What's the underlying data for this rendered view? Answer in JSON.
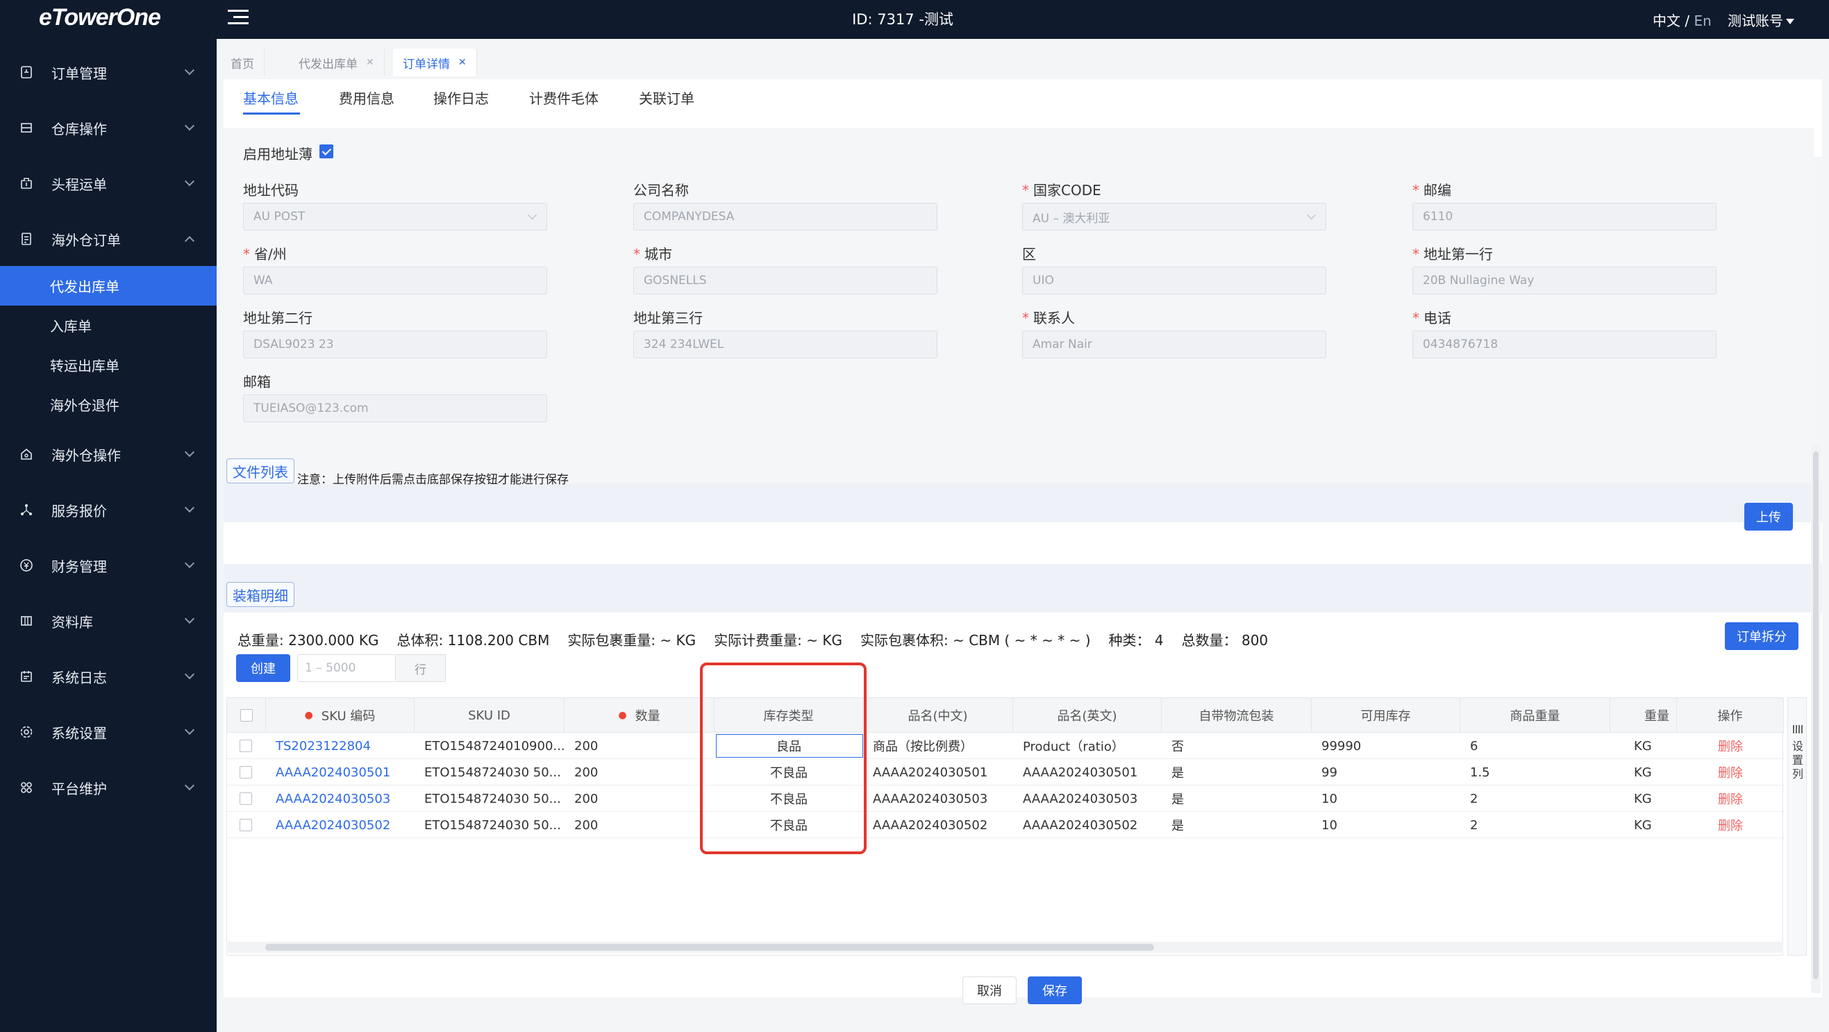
{
  "topbar": {
    "logo": "eTowerOne",
    "title": "ID: 7317 -测试",
    "lang_zh": "中文 / ",
    "lang_en": "En",
    "account": "测试账号"
  },
  "sidebar": {
    "items": [
      {
        "label": "订单管理",
        "icon": "order-icon"
      },
      {
        "label": "仓库操作",
        "icon": "warehouse-icon"
      },
      {
        "label": "头程运单",
        "icon": "shipment-icon"
      },
      {
        "label": "海外仓订单",
        "icon": "document-icon"
      },
      {
        "label": "海外仓操作",
        "icon": "overseas-warehouse-icon"
      },
      {
        "label": "服务报价",
        "icon": "quote-icon"
      },
      {
        "label": "财务管理",
        "icon": "finance-icon"
      },
      {
        "label": "资料库",
        "icon": "database-icon"
      },
      {
        "label": "系统日志",
        "icon": "log-icon"
      },
      {
        "label": "系统设置",
        "icon": "settings-icon"
      },
      {
        "label": "平台维护",
        "icon": "platform-icon"
      }
    ],
    "sub_items": [
      "代发出库单",
      "入库单",
      "转运出库单",
      "海外仓退件"
    ]
  },
  "page_tabs": [
    "首页",
    "代发出库单",
    "订单详情"
  ],
  "sub_tabs": [
    "基本信息",
    "费用信息",
    "操作日志",
    "计费件毛体",
    "关联订单"
  ],
  "address": {
    "use_book_label": "启用地址薄",
    "fields": [
      {
        "label": "地址代码",
        "value": "AU POST",
        "required": false
      },
      {
        "label": "公司名称",
        "value": "COMPANYDESA",
        "required": false
      },
      {
        "label": "国家CODE",
        "value": "AU – 澳大利亚",
        "required": true
      },
      {
        "label": "邮编",
        "value": "6110",
        "required": true
      },
      {
        "label": "省/州",
        "value": "WA",
        "required": true
      },
      {
        "label": "城市",
        "value": "GOSNELLS",
        "required": true
      },
      {
        "label": "区",
        "value": "UIO",
        "required": false
      },
      {
        "label": "地址第一行",
        "value": "20B Nullagine Way",
        "required": true
      },
      {
        "label": "地址第二行",
        "value": "DSAL9023 23",
        "required": false
      },
      {
        "label": "地址第三行",
        "value": "324 234LWEL",
        "required": false
      },
      {
        "label": "联系人",
        "value": "Amar Nair",
        "required": true
      },
      {
        "label": "电话",
        "value": "0434876718",
        "required": true
      },
      {
        "label": "邮箱",
        "value": "TUEIASO@123.com",
        "required": false
      }
    ]
  },
  "files": {
    "tag": "文件列表",
    "note": "注意：上传附件后需点击底部保存按钮才能进行保存",
    "upload": "上传"
  },
  "packing": {
    "tag": "装箱明细",
    "summary": [
      "总重量: 2300.000 KG",
      "总体积: 1108.200 CBM",
      "实际包裹重量: ~ KG",
      "实际计费重量: ~ KG",
      "实际包裹体积: ~ CBM ( ~ * ~ * ~ )",
      "种类： 4",
      "总数量： 800"
    ],
    "split_button": "订单拆分",
    "create_button": "创建",
    "range_placeholder": "1 – 5000",
    "row_unit": "行",
    "columns": [
      "SKU 编码",
      "SKU ID",
      "数量",
      "库存类型",
      "品名(中文)",
      "品名(英文)",
      "自带物流包装",
      "可用库存",
      "商品重量",
      "重量",
      "操作"
    ],
    "rows": [
      [
        "TS2023122804",
        "ETO1548724010900...",
        "200",
        "良品",
        "商品（按比例费）",
        "Product（ratio）",
        "否",
        "99990",
        "6",
        "KG",
        "删除"
      ],
      [
        "AAAA2024030501",
        "ETO1548724030 50...",
        "200",
        "不良品",
        "AAAA2024030501",
        "AAAA2024030501",
        "是",
        "99",
        "1.5",
        "KG",
        "删除"
      ],
      [
        "AAAA2024030503",
        "ETO1548724030 50...",
        "200",
        "不良品",
        "AAAA2024030503",
        "AAAA2024030503",
        "是",
        "10",
        "2",
        "KG",
        "删除"
      ],
      [
        "AAAA2024030502",
        "ETO1548724030 50...",
        "200",
        "不良品",
        "AAAA2024030502",
        "AAAA2024030502",
        "是",
        "10",
        "2",
        "KG",
        "删除"
      ]
    ],
    "settings_label": "设置列"
  },
  "footer": {
    "cancel": "取消",
    "save": "保存"
  },
  "colors": {
    "accent": "#2e6be6",
    "sidebar_bg": "#0f1a2c",
    "danger": "#f06464",
    "highlight": "#e1372d"
  }
}
